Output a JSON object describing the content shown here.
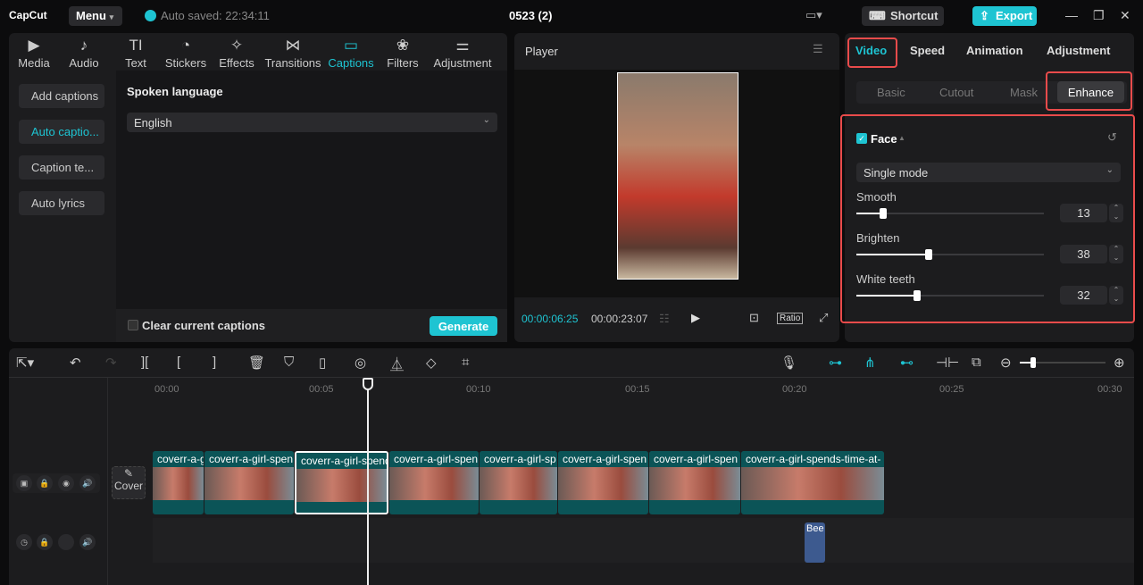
{
  "app": {
    "name": "CapCut",
    "menu": "Menu",
    "autosave": "Auto saved: 22:34:11",
    "project_title": "0523 (2)",
    "shortcut": "Shortcut",
    "export": "Export"
  },
  "toolbar_tabs": [
    {
      "label": "Media",
      "icon": "▶"
    },
    {
      "label": "Audio",
      "icon": "♪"
    },
    {
      "label": "Text",
      "icon": "TI"
    },
    {
      "label": "Stickers",
      "icon": "◔"
    },
    {
      "label": "Effects",
      "icon": "✧"
    },
    {
      "label": "Transitions",
      "icon": "⋈"
    },
    {
      "label": "Captions",
      "icon": "▭"
    },
    {
      "label": "Filters",
      "icon": "❀"
    },
    {
      "label": "Adjustment",
      "icon": "⚌"
    }
  ],
  "captions": {
    "side": [
      "Add captions",
      "Auto captio...",
      "Caption te...",
      "Auto lyrics"
    ],
    "spoken_language_label": "Spoken language",
    "language": "English",
    "clear_label": "Clear current captions",
    "generate": "Generate"
  },
  "player": {
    "title": "Player",
    "current_time": "00:00:06:25",
    "total_time": "00:00:23:07",
    "ratio": "Ratio"
  },
  "right": {
    "tabs": [
      "Video",
      "Speed",
      "Animation",
      "Adjustment"
    ],
    "subtabs": [
      "Basic",
      "Cutout",
      "Mask",
      "Enhance"
    ],
    "face_label": "Face",
    "mode": "Single mode",
    "sliders": [
      {
        "label": "Smooth",
        "value": 13
      },
      {
        "label": "Brighten",
        "value": 38
      },
      {
        "label": "White teeth",
        "value": 32
      }
    ],
    "accent": "#1ec4d2",
    "highlight": "#e94b4b"
  },
  "timeline": {
    "ticks": [
      "00:00",
      "00:05",
      "00:10",
      "00:15",
      "00:20",
      "00:25",
      "00:30"
    ],
    "cover": "Cover",
    "clips": [
      "coverr-a-g",
      "coverr-a-girl-spen",
      "coverr-a-girl-spend",
      "coverr-a-girl-spen",
      "coverr-a-girl-sp",
      "coverr-a-girl-spen",
      "coverr-a-girl-spen",
      "coverr-a-girl-spends-time-at-"
    ],
    "audio_clip": "Bee"
  }
}
